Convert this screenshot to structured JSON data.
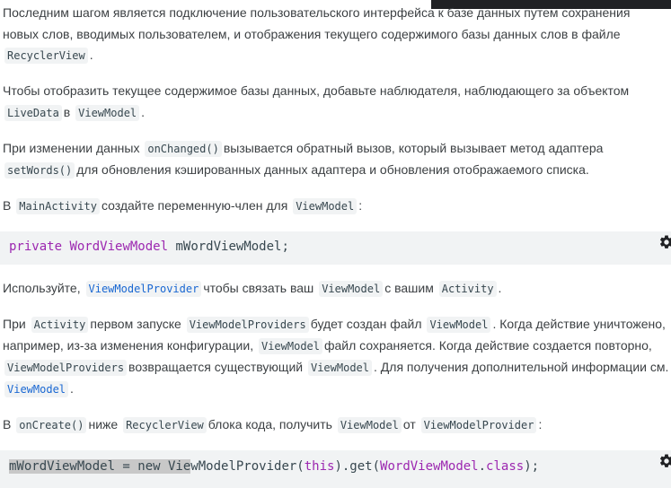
{
  "paragraphs": {
    "p1": {
      "line1": "Последним шагом является подключение пользовательского интерфейса к базе данных путем сохранения",
      "line2": "новых слов, вводимых пользователем, и отображения текущего содержимого базы данных слов в файле",
      "code1": "RecyclerView",
      "end": "."
    },
    "p2": {
      "text1": "Чтобы отобразить текущее содержимое базы данных, добавьте наблюдателя, наблюдающего за объектом",
      "code1": "LiveData",
      "text2": "в",
      "code2": "ViewModel",
      "end": "."
    },
    "p3": {
      "text1": "При изменении данных",
      "code1": "onChanged()",
      "text2": "вызывается обратный вызов, который вызывает метод адаптера",
      "code2": "setWords()",
      "text3": "для обновления кэшированных данных адаптера и обновления отображаемого списка."
    },
    "p4": {
      "text1": "В",
      "code1": "MainActivity",
      "text2": "создайте переменную-член для",
      "code2": "ViewModel",
      "end": ":"
    },
    "p5": {
      "text1": "Используйте,",
      "code1": "ViewModelProvider",
      "text2": "чтобы связать ваш",
      "code2": "ViewModel",
      "text3": "с вашим",
      "code3": "Activity",
      "end": "."
    },
    "p6": {
      "text1": "При",
      "code1": "Activity",
      "text2": "первом запуске",
      "code2": "ViewModelProviders",
      "text3": "будет создан файл",
      "code3": "ViewModel",
      "text4": ". Когда действие уничтожено,",
      "text5": "например, из-за изменения конфигурации,",
      "code4": "ViewModel",
      "text6": "файл сохраняется. Когда действие создается повторно,",
      "code5": "ViewModelProviders",
      "text7": "возвращается существующий",
      "code6": "ViewModel",
      "text8": ". Для получения дополнительной информации см.",
      "code7": "ViewModel",
      "end": "."
    },
    "p7": {
      "text1": "В",
      "code1": "onCreate()",
      "text2": "ниже",
      "code2": "RecyclerView",
      "text3": "блока кода, получить",
      "code3": "ViewModel",
      "text4": "от",
      "code4": "ViewModelProvider",
      "end": ":"
    }
  },
  "codeblock1": {
    "kw": "private",
    "type": "WordViewModel",
    "rest": " mWordViewModel;"
  },
  "codeblock2": {
    "sel": "mWordViewModel = new Vie",
    "rest1": "wModelProvider(",
    "this": "this",
    "rest2": ").get(",
    "cls": "WordViewModel",
    "dot": ".",
    "clskw": "class",
    "rest3": ");"
  },
  "icons": {
    "copy": "gear-icon"
  },
  "colors": {
    "keyword": "#9c27b0",
    "link": "#1967d2",
    "code_bg": "#f1f3f4"
  }
}
